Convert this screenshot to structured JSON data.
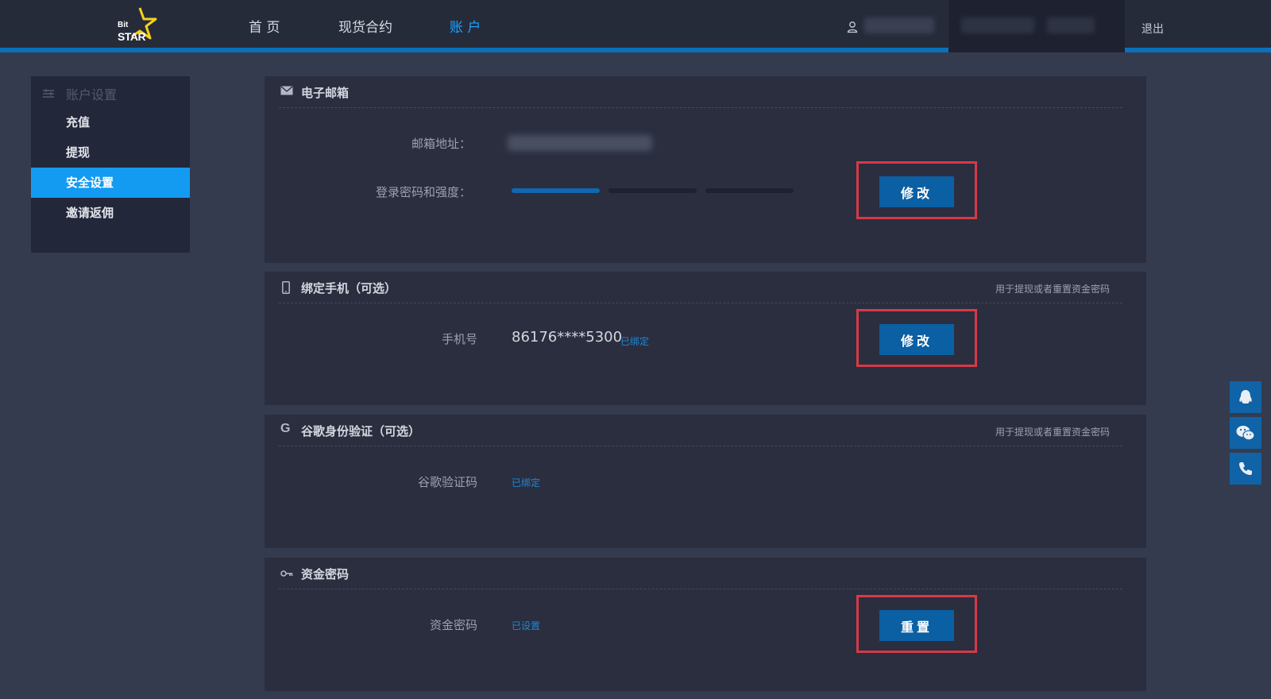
{
  "header": {
    "logo_small": "Bit",
    "logo_big": "STAR",
    "nav": [
      {
        "label": "首 页",
        "active": false
      },
      {
        "label": "现货合约",
        "active": false
      },
      {
        "label": "账 户",
        "active": true
      }
    ],
    "logout": "退出"
  },
  "sidebar": {
    "heading": "账户设置",
    "items": [
      {
        "label": "充值",
        "active": false
      },
      {
        "label": "提现",
        "active": false
      },
      {
        "label": "安全设置",
        "active": true
      },
      {
        "label": "邀请返佣",
        "active": false
      }
    ]
  },
  "email_card": {
    "title": "电子邮箱",
    "email_label": "邮箱地址：",
    "password_label": "登录密码和强度：",
    "strength_level": 1,
    "strength_total": 3,
    "button": "修改"
  },
  "phone_card": {
    "title": "绑定手机（可选）",
    "hint": "用于提现或者重置资金密码",
    "phone_label": "手机号",
    "phone_value": "86176****5300",
    "status": "已绑定",
    "button": "修改"
  },
  "google_card": {
    "title": "谷歌身份验证（可选）",
    "hint": "用于提现或者重置资金密码",
    "code_label": "谷歌验证码",
    "status": "已绑定"
  },
  "fund_card": {
    "title": "资金密码",
    "label": "资金密码",
    "status": "已设置",
    "button": "重置"
  },
  "colors": {
    "accent": "#139bf2",
    "button": "#0b5fa3",
    "highlight_border": "#d63a46",
    "strength_on": "#1068b0",
    "strength_off": "#1d2130"
  }
}
